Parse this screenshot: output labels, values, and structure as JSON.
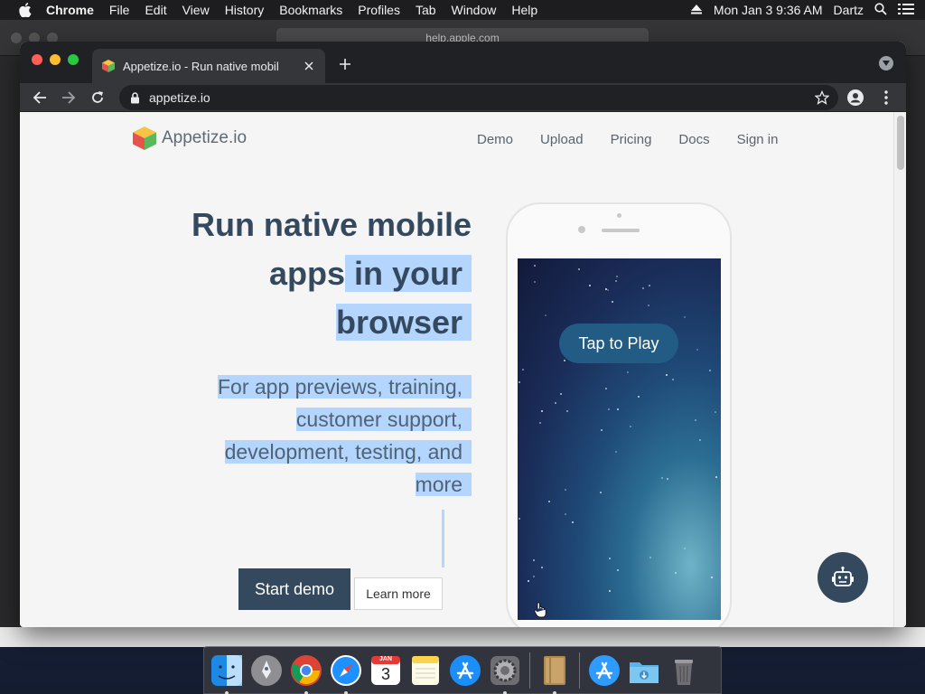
{
  "menubar": {
    "app_name": "Chrome",
    "menus": [
      "File",
      "Edit",
      "View",
      "History",
      "Bookmarks",
      "Profiles",
      "Tab",
      "Window",
      "Help"
    ],
    "datetime": "Mon Jan 3  9:36 AM",
    "user": "Dartz"
  },
  "background_window": {
    "url": "help.apple.com"
  },
  "browser": {
    "tab_title": "Appetize.io - Run native mobile apps in your browser",
    "url": "appetize.io"
  },
  "site": {
    "logo_text": "Appetize.io",
    "nav": [
      "Demo",
      "Upload",
      "Pricing",
      "Docs",
      "Sign in"
    ],
    "hero": {
      "title_line1": "Run native mobile",
      "title_line2a": "apps",
      "title_line2b": " in your",
      "title_line3": "browser",
      "sub_line1": "For app previews, training,",
      "sub_line2": "customer support,",
      "sub_line3": "development, testing, and",
      "sub_line4": "more"
    },
    "start_demo_label": "Start demo",
    "learn_more_label": "Learn more",
    "tap_to_play_label": "Tap to Play"
  },
  "colors": {
    "accent": "#34495e",
    "selection": "#b4d5fe",
    "tap_button": "#225b84"
  },
  "dock": {
    "icons": [
      "finder-icon",
      "launchpad-icon",
      "chrome-icon",
      "safari-icon",
      "calendar-icon",
      "notes-icon",
      "app-store-icon",
      "system-preferences-icon",
      "books-icon",
      "app-store-folder-icon",
      "downloads-folder-icon",
      "trash-icon"
    ],
    "calendar_month": "JAN",
    "calendar_day": "3"
  }
}
